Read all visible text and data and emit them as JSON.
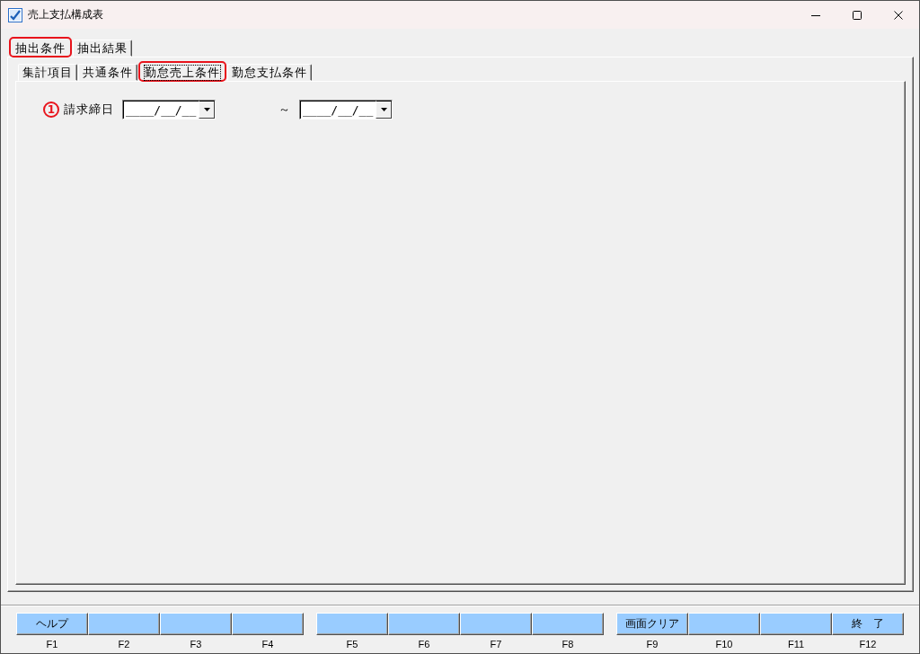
{
  "window": {
    "title": "売上支払構成表"
  },
  "tabs": [
    {
      "label": "抽出条件",
      "selected": true,
      "highlighted": true
    },
    {
      "label": "抽出結果",
      "selected": false,
      "highlighted": false
    }
  ],
  "subtabs": [
    {
      "label": "集計項目",
      "selected": false,
      "highlighted": false
    },
    {
      "label": "共通条件",
      "selected": false,
      "highlighted": false
    },
    {
      "label": "勤怠売上条件",
      "selected": true,
      "highlighted": true
    },
    {
      "label": "勤怠支払条件",
      "selected": false,
      "highlighted": false
    }
  ],
  "form": {
    "callout": "1",
    "label": "請求締日",
    "from": {
      "placeholder": "____/__/__"
    },
    "separator": "～",
    "to": {
      "placeholder": "____/__/__"
    }
  },
  "function_keys": {
    "groups": [
      {
        "keys": [
          {
            "key": "F1",
            "label": "ヘルプ"
          },
          {
            "key": "F2"
          },
          {
            "key": "F3"
          },
          {
            "key": "F4"
          }
        ]
      },
      {
        "keys": [
          {
            "key": "F5"
          },
          {
            "key": "F6"
          },
          {
            "key": "F7"
          },
          {
            "key": "F8"
          }
        ]
      },
      {
        "keys": [
          {
            "key": "F9",
            "label": "画面クリア"
          },
          {
            "key": "F10"
          },
          {
            "key": "F11"
          },
          {
            "key": "F12",
            "label": "終　了"
          }
        ]
      }
    ]
  }
}
